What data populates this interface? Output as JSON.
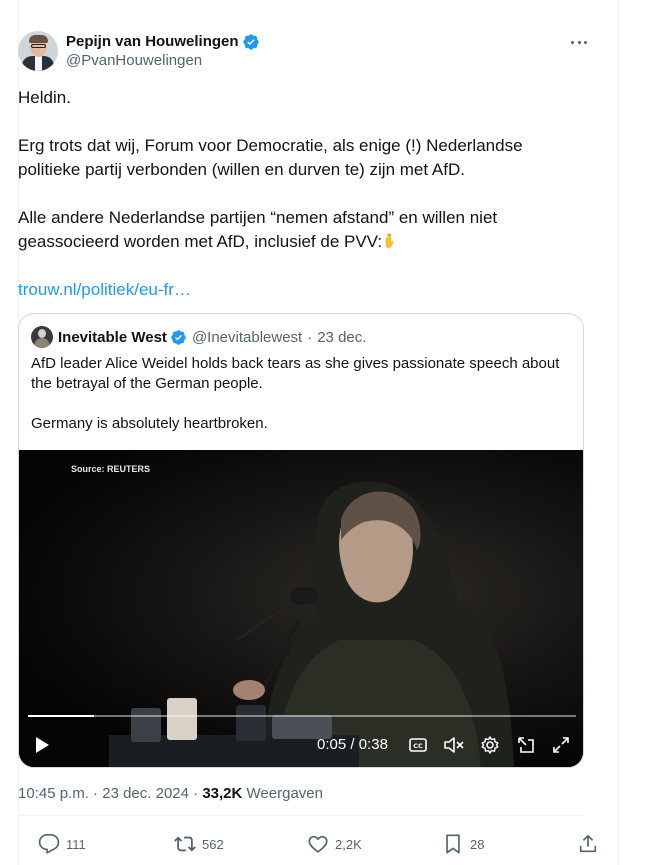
{
  "author": {
    "display_name": "Pepijn van Houwelingen",
    "handle": "@PvanHouwelingen",
    "verified": true
  },
  "tweet": {
    "paragraphs": [
      "Heldin.",
      "Erg trots dat wij, Forum voor Democratie, als enige (!) Nederlandse politieke partij verbonden (willen en durven te) zijn met AfD.",
      "Alle andere Nederlandse partijen “nemen afstand” en willen niet geassocieerd worden met AfD, inclusief de PVV:"
    ],
    "emoji": "pointing-down-hand",
    "link": "trouw.nl/politiek/eu-fr…"
  },
  "quote": {
    "display_name": "Inevitable West",
    "handle": "@Inevitablewest",
    "separator": "·",
    "date": "23 dec.",
    "text_lines": [
      "AfD leader Alice Weidel holds back tears as she gives passionate speech about the betrayal of the German people.",
      "Germany is absolutely heartbroken."
    ],
    "video": {
      "source_label": "Source: REUTERS",
      "progress": 0.12,
      "current_time": "0:05",
      "time_separator": " / ",
      "duration": "0:38"
    }
  },
  "meta": {
    "time": "10:45 p.m.",
    "separator": " · ",
    "date": "23 dec. 2024",
    "views": "33,2K",
    "views_label": "Weergaven"
  },
  "actions": {
    "replies": "111",
    "reposts": "562",
    "likes": "2,2K",
    "bookmarks": "28"
  },
  "colors": {
    "accent": "#1d9bf0",
    "text": "#0f1419",
    "secondary": "#536471",
    "border": "#cfd9de"
  }
}
